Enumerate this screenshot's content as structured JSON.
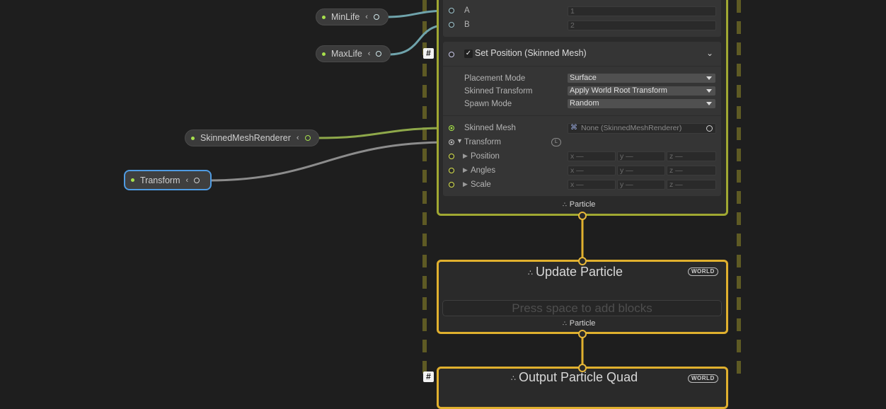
{
  "properties": {
    "minlife": "MinLife",
    "maxlife": "MaxLife",
    "skinned_renderer": "SkinnedMeshRenderer",
    "transform": "Transform"
  },
  "random_block": {
    "a_label": "A",
    "a_value": "1",
    "b_label": "B",
    "b_value": "2"
  },
  "set_position": {
    "title": "Set Position (Skinned Mesh)",
    "placement_mode_label": "Placement Mode",
    "placement_mode_value": "Surface",
    "skinned_transform_label": "Skinned Transform",
    "skinned_transform_value": "Apply World Root Transform",
    "spawn_mode_label": "Spawn Mode",
    "spawn_mode_value": "Random",
    "skinned_mesh_label": "Skinned Mesh",
    "skinned_mesh_value": "None (SkinnedMeshRenderer)",
    "transform_label": "Transform",
    "transform_badge": "L",
    "position_label": "Position",
    "angles_label": "Angles",
    "scale_label": "Scale",
    "x": "x",
    "y": "y",
    "z": "z",
    "empty": "—"
  },
  "initialize_context": {
    "output_label": "Particle"
  },
  "update_context": {
    "title": "Update Particle",
    "space_badge": "WORLD",
    "placeholder": "Press space to add blocks",
    "output_label": "Particle"
  },
  "output_context": {
    "title": "Output Particle Quad",
    "space_badge": "WORLD"
  },
  "hash_symbol": "#",
  "colors": {
    "background": "#1e1e1e",
    "context_border": "#e0b02e",
    "initialize_border": "#a0a832",
    "float_wire": "#6fa3ab",
    "object_wire": "#8ea84a",
    "transform_wire": "#8c8c8c",
    "selection": "#4f9be2"
  }
}
